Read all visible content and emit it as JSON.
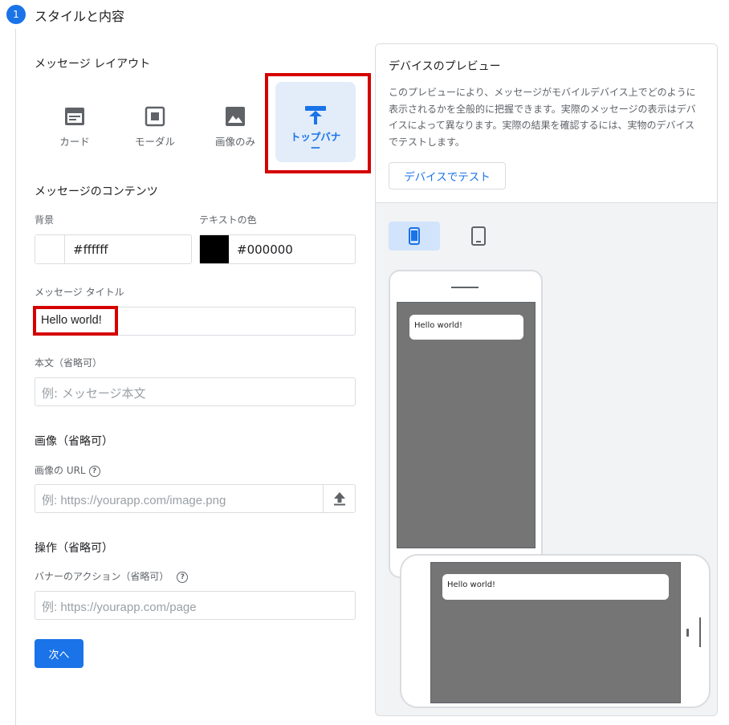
{
  "step": {
    "number": "1",
    "title": "スタイルと内容"
  },
  "layout": {
    "heading": "メッセージ レイアウト",
    "options": [
      {
        "label": "カード",
        "icon": "card-icon",
        "selected": false
      },
      {
        "label": "モーダル",
        "icon": "modal-icon",
        "selected": false
      },
      {
        "label": "画像のみ",
        "icon": "image-icon",
        "selected": false
      },
      {
        "label": "トップバナー",
        "icon": "top-banner-icon",
        "selected": true
      }
    ]
  },
  "content": {
    "heading": "メッセージのコンテンツ",
    "background_label": "背景",
    "background_value": "#ffffff",
    "text_color_label": "テキストの色",
    "text_color_value": "#000000",
    "title_label": "メッセージ タイトル",
    "title_value": "Hello world!",
    "body_label": "本文（省略可）",
    "body_placeholder": "例: メッセージ本文"
  },
  "image_section": {
    "heading": "画像（省略可）",
    "url_label": "画像の URL",
    "url_placeholder": "例: https://yourapp.com/image.png"
  },
  "action_section": {
    "heading": "操作（省略可）",
    "action_label": "バナーのアクション（省略可）",
    "action_placeholder": "例: https://yourapp.com/page"
  },
  "next_button": "次へ",
  "preview": {
    "title": "デバイスのプレビュー",
    "description": "このプレビューにより、メッセージがモバイルデバイス上でどのように表示されるかを全般的に把握できます。実際のメッセージの表示はデバイスによって異なります。実際の結果を確認するには、実物のデバイスでテストします。",
    "test_button": "デバイスでテスト",
    "portrait_banner_text": "Hello world!",
    "landscape_banner_text": "Hello world!"
  },
  "colors": {
    "accent": "#1a73e8",
    "highlight_red": "#d50000",
    "preview_screen": "#757575"
  }
}
